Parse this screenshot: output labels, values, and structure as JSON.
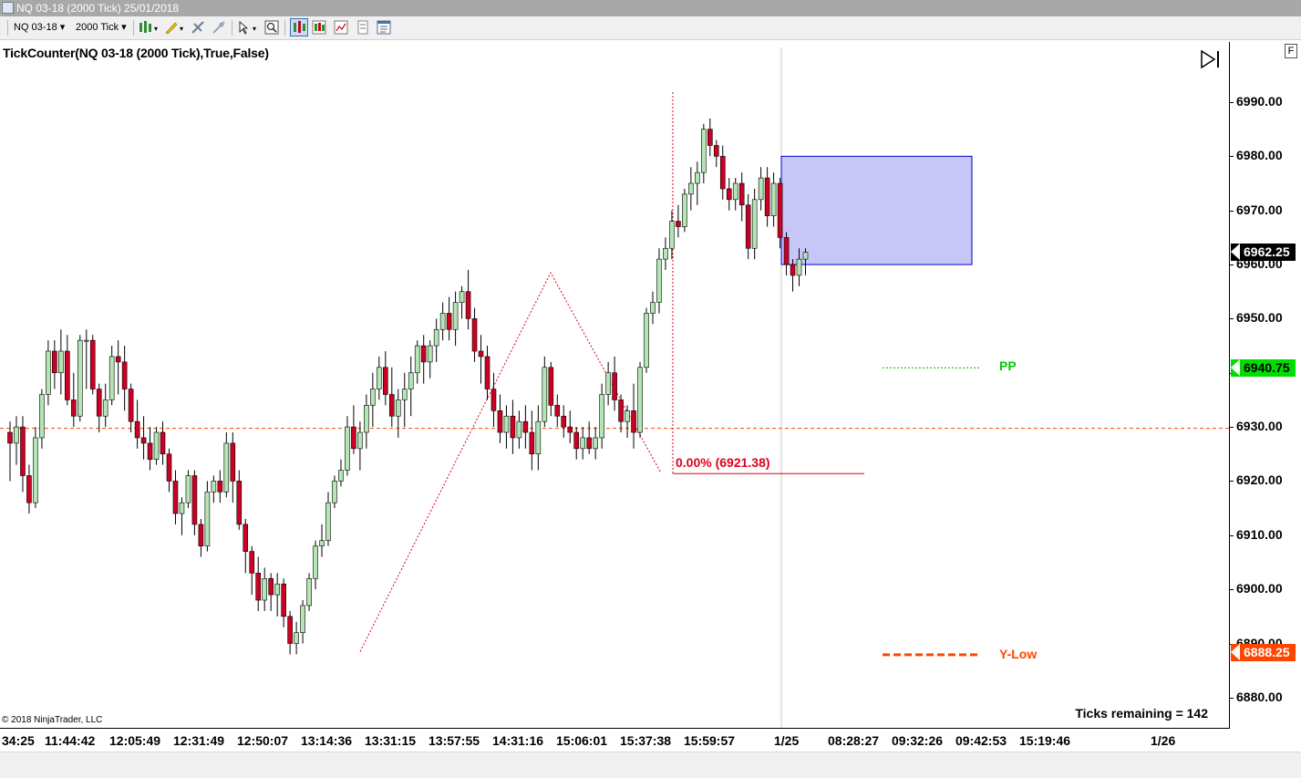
{
  "window": {
    "title": "NQ 03-18 (2000 Tick)  25/01/2018"
  },
  "toolbar": {
    "instrument": "NQ 03-18",
    "interval": "2000 Tick",
    "icons": [
      "bar-type-icon",
      "drawing-pencil-icon",
      "crosshair-icon",
      "pointer-icon",
      "zoom-icon",
      "chart-trader-icon",
      "candlestick-icon",
      "line-chart-icon",
      "data-box-icon",
      "properties-icon"
    ]
  },
  "indicator": {
    "name": "TickCounter",
    "params": "(NQ 03-18 (2000 Tick),True,False)"
  },
  "copyright": "© 2018 NinjaTrader, LLC",
  "ticks_remaining": "Ticks remaining = 142",
  "corner": "F",
  "chart_data": {
    "type": "candlestick",
    "ylim": [
      6876,
      7002
    ],
    "y_ticks": [
      "6990.00",
      "6980.00",
      "6970.00",
      "6960.00",
      "6950.00",
      "6940.00",
      "6930.00",
      "6920.00",
      "6910.00",
      "6900.00",
      "6890.00",
      "6880.00"
    ],
    "x_ticks": [
      "34:25",
      "11:44:42",
      "12:05:49",
      "12:31:49",
      "12:50:07",
      "13:14:36",
      "13:31:15",
      "13:57:55",
      "14:31:16",
      "15:06:01",
      "15:37:38",
      "15:59:57",
      "1/25",
      "08:28:27",
      "09:32:26",
      "09:42:53",
      "15:19:46",
      "1/26"
    ],
    "last_price": "6962.25",
    "levels": [
      {
        "name": "PP",
        "value": 6940.75,
        "label": "6940.75",
        "color": "#00cc00"
      },
      {
        "name": "Y-Low",
        "value": 6888.25,
        "label": "6888.25",
        "color": "#ff4500"
      }
    ],
    "y_close_line": 6929.75,
    "fib_label": "0.00% (6921.38)",
    "fib_value": 6921.38,
    "zigzag": [
      [
        0,
        6888.5
      ],
      [
        1,
        6958.5
      ],
      [
        2,
        6921.5
      ]
    ],
    "box": {
      "top": 6980,
      "bottom": 6960
    },
    "colors": {
      "up": "#b3e6b3",
      "down": "#cc0022",
      "box_fill": "#c3c3f7",
      "box_stroke": "#0000cc"
    },
    "candles": [
      [
        6929,
        6931,
        6920,
        6927
      ],
      [
        6927,
        6932,
        6923,
        6930
      ],
      [
        6930,
        6932,
        6918,
        6921
      ],
      [
        6921,
        6923,
        6914,
        6916
      ],
      [
        6916,
        6930,
        6915,
        6928
      ],
      [
        6928,
        6937,
        6926,
        6936
      ],
      [
        6936,
        6946,
        6934,
        6944
      ],
      [
        6944,
        6946,
        6937,
        6940
      ],
      [
        6940,
        6948,
        6936,
        6944
      ],
      [
        6944,
        6947,
        6934,
        6935
      ],
      [
        6935,
        6940,
        6930,
        6932
      ],
      [
        6932,
        6947,
        6931,
        6946
      ],
      [
        6946,
        6948,
        6937,
        6946
      ],
      [
        6946,
        6947,
        6936,
        6937
      ],
      [
        6937,
        6938,
        6929,
        6932
      ],
      [
        6932,
        6938,
        6930,
        6935
      ],
      [
        6935,
        6945,
        6934,
        6943
      ],
      [
        6943,
        6946,
        6936,
        6942
      ],
      [
        6942,
        6945,
        6933,
        6937
      ],
      [
        6937,
        6938,
        6929,
        6931
      ],
      [
        6931,
        6935,
        6926,
        6928
      ],
      [
        6928,
        6932,
        6924,
        6927
      ],
      [
        6927,
        6930,
        6922,
        6924
      ],
      [
        6924,
        6930,
        6923,
        6929
      ],
      [
        6929,
        6931,
        6923,
        6925
      ],
      [
        6925,
        6926,
        6918,
        6920
      ],
      [
        6920,
        6922,
        6912,
        6914
      ],
      [
        6914,
        6917,
        6910,
        6916
      ],
      [
        6916,
        6922,
        6915,
        6921
      ],
      [
        6921,
        6922,
        6910,
        6912
      ],
      [
        6912,
        6913,
        6906,
        6908
      ],
      [
        6908,
        6920,
        6907,
        6918
      ],
      [
        6918,
        6921,
        6916,
        6920
      ],
      [
        6920,
        6922,
        6916,
        6918
      ],
      [
        6918,
        6929,
        6917,
        6927
      ],
      [
        6927,
        6929,
        6916,
        6920
      ],
      [
        6920,
        6922,
        6911,
        6912
      ],
      [
        6912,
        6913,
        6903,
        6907
      ],
      [
        6907,
        6908,
        6899,
        6903
      ],
      [
        6903,
        6906,
        6896,
        6898
      ],
      [
        6898,
        6904,
        6896,
        6902
      ],
      [
        6902,
        6903,
        6896,
        6899
      ],
      [
        6899,
        6903,
        6895,
        6901
      ],
      [
        6901,
        6902,
        6893,
        6895
      ],
      [
        6895,
        6896,
        6888,
        6890
      ],
      [
        6890,
        6894,
        6888,
        6892
      ],
      [
        6892,
        6898,
        6890,
        6897
      ],
      [
        6897,
        6903,
        6896,
        6902
      ],
      [
        6902,
        6909,
        6900,
        6908
      ],
      [
        6908,
        6912,
        6906,
        6909
      ],
      [
        6909,
        6918,
        6908,
        6916
      ],
      [
        6916,
        6921,
        6915,
        6920
      ],
      [
        6920,
        6924,
        6919,
        6922
      ],
      [
        6922,
        6932,
        6921,
        6930
      ],
      [
        6930,
        6934,
        6925,
        6926
      ],
      [
        6926,
        6931,
        6922,
        6929
      ],
      [
        6929,
        6936,
        6926,
        6934
      ],
      [
        6934,
        6940,
        6930,
        6937
      ],
      [
        6937,
        6943,
        6935,
        6941
      ],
      [
        6941,
        6944,
        6934,
        6936
      ],
      [
        6936,
        6941,
        6930,
        6932
      ],
      [
        6932,
        6937,
        6928,
        6935
      ],
      [
        6935,
        6940,
        6930,
        6937
      ],
      [
        6937,
        6943,
        6932,
        6940
      ],
      [
        6940,
        6946,
        6938,
        6945
      ],
      [
        6945,
        6947,
        6938,
        6942
      ],
      [
        6942,
        6946,
        6939,
        6945
      ],
      [
        6945,
        6950,
        6942,
        6948
      ],
      [
        6948,
        6953,
        6946,
        6951
      ],
      [
        6951,
        6954,
        6946,
        6948
      ],
      [
        6948,
        6955,
        6945,
        6953
      ],
      [
        6953,
        6956,
        6950,
        6955
      ],
      [
        6955,
        6959,
        6948,
        6950
      ],
      [
        6950,
        6952,
        6942,
        6944
      ],
      [
        6944,
        6947,
        6938,
        6943
      ],
      [
        6943,
        6945,
        6935,
        6937
      ],
      [
        6937,
        6940,
        6930,
        6933
      ],
      [
        6933,
        6936,
        6927,
        6929
      ],
      [
        6929,
        6934,
        6926,
        6932
      ],
      [
        6932,
        6935,
        6925,
        6928
      ],
      [
        6928,
        6933,
        6926,
        6931
      ],
      [
        6931,
        6934,
        6926,
        6929
      ],
      [
        6929,
        6933,
        6922,
        6925
      ],
      [
        6925,
        6934,
        6922,
        6931
      ],
      [
        6931,
        6943,
        6930,
        6941
      ],
      [
        6941,
        6942,
        6932,
        6934
      ],
      [
        6934,
        6936,
        6930,
        6932
      ],
      [
        6932,
        6934,
        6928,
        6930
      ],
      [
        6930,
        6933,
        6927,
        6929
      ],
      [
        6929,
        6930,
        6924,
        6926
      ],
      [
        6926,
        6930,
        6924,
        6928
      ],
      [
        6928,
        6931,
        6925,
        6926
      ],
      [
        6926,
        6930,
        6924,
        6928
      ],
      [
        6928,
        6938,
        6926,
        6936
      ],
      [
        6936,
        6942,
        6934,
        6940
      ],
      [
        6940,
        6943,
        6933,
        6935
      ],
      [
        6935,
        6936,
        6929,
        6931
      ],
      [
        6931,
        6934,
        6928,
        6933
      ],
      [
        6933,
        6938,
        6926,
        6929
      ],
      [
        6929,
        6942,
        6928,
        6941
      ],
      [
        6941,
        6952,
        6940,
        6951
      ],
      [
        6951,
        6955,
        6949,
        6953
      ],
      [
        6953,
        6963,
        6951,
        6961
      ],
      [
        6961,
        6965,
        6959,
        6963
      ],
      [
        6963,
        6970,
        6961,
        6968
      ],
      [
        6968,
        6971,
        6965,
        6967
      ],
      [
        6967,
        6974,
        6966,
        6973
      ],
      [
        6973,
        6978,
        6970,
        6975
      ],
      [
        6975,
        6979,
        6971,
        6977
      ],
      [
        6977,
        6986,
        6975,
        6985
      ],
      [
        6985,
        6987,
        6980,
        6982
      ],
      [
        6982,
        6983,
        6978,
        6980
      ],
      [
        6980,
        6982,
        6972,
        6974
      ],
      [
        6974,
        6976,
        6970,
        6972
      ],
      [
        6972,
        6976,
        6970,
        6975
      ],
      [
        6975,
        6977,
        6968,
        6971
      ],
      [
        6971,
        6973,
        6961,
        6963
      ],
      [
        6963,
        6974,
        6961,
        6972
      ],
      [
        6972,
        6978,
        6970,
        6976
      ],
      [
        6976,
        6978,
        6967,
        6969
      ],
      [
        6969,
        6977,
        6967,
        6975
      ],
      [
        6975,
        6976,
        6963,
        6965
      ],
      [
        6965,
        6966,
        6958,
        6960
      ],
      [
        6960,
        6961,
        6955,
        6958
      ],
      [
        6958,
        6963,
        6956,
        6961
      ],
      [
        6961,
        6963,
        6958,
        6962.25
      ]
    ]
  }
}
